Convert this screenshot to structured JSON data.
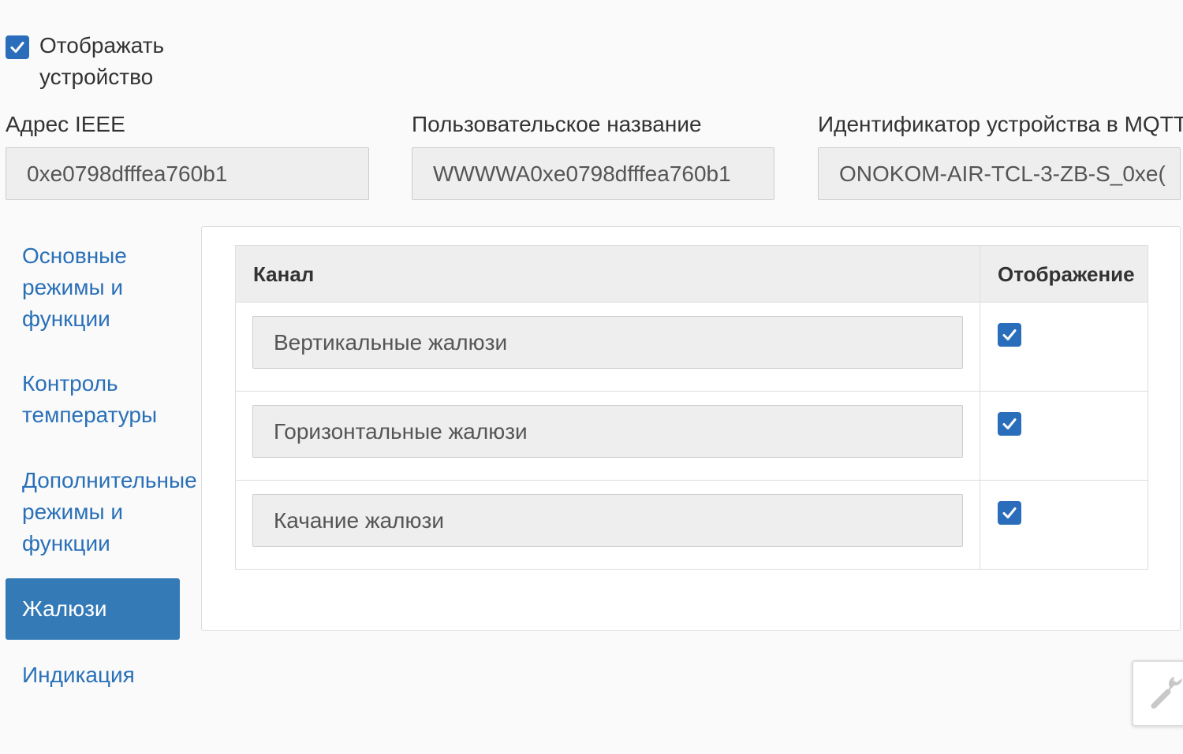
{
  "show_device": {
    "label": "Отображать устройство",
    "checked": true
  },
  "fields": {
    "ieee": {
      "label": "Адрес IEEE",
      "value": "0xe0798dfffea760b1"
    },
    "custom_name": {
      "label": "Пользовательское название",
      "value": "WWWWA0xe0798dfffea760b1"
    },
    "mqtt_id": {
      "label": "Идентификатор устройства в MQTT",
      "value": "ONOKOM-AIR-TCL-3-ZB-S_0xe("
    }
  },
  "nav": {
    "items": [
      {
        "label": "Основные режимы и функции",
        "active": false
      },
      {
        "label": "Контроль температуры",
        "active": false
      },
      {
        "label": "Дополнительные режимы и функции",
        "active": false
      },
      {
        "label": "Жалюзи",
        "active": true
      },
      {
        "label": "Индикация",
        "active": false
      }
    ]
  },
  "table": {
    "headers": {
      "channel": "Канал",
      "display": "Отображение"
    },
    "rows": [
      {
        "channel": "Вертикальные жалюзи",
        "display": true
      },
      {
        "channel": "Горизонтальные жалюзи",
        "display": true
      },
      {
        "channel": "Качание жалюзи",
        "display": true
      }
    ]
  },
  "colors": {
    "accent": "#337ab7",
    "link": "#2a70b8",
    "checkbox": "#2a6ebb"
  },
  "icons": {
    "tool_button": "wrench-icon"
  }
}
